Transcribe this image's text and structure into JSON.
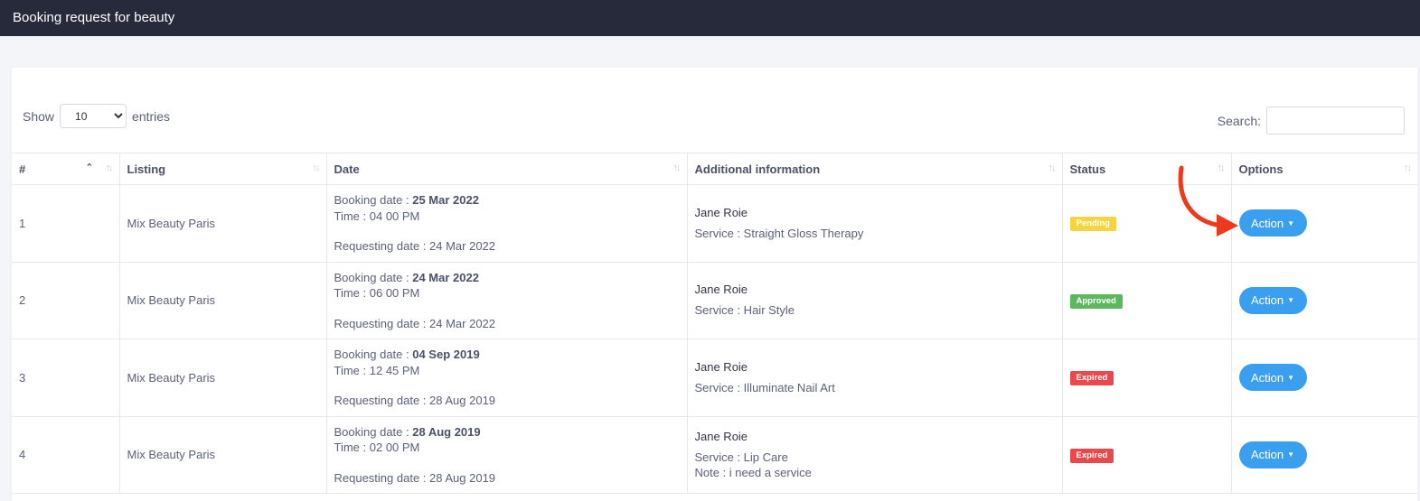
{
  "header": {
    "title": "Booking request for beauty"
  },
  "controls": {
    "show_label": "Show",
    "entries_value": "10",
    "entries_label": "entries",
    "search_label": "Search:"
  },
  "table": {
    "columns": [
      "#",
      "Listing",
      "Date",
      "Additional information",
      "Status",
      "Options"
    ],
    "rows": [
      {
        "num": "1",
        "listing": "Mix Beauty Paris",
        "booking_label": "Booking date : ",
        "booking_date": "25 Mar 2022",
        "time": "Time : 04 00 PM",
        "requesting": "Requesting date : 24 Mar 2022",
        "name": "Jane Roie",
        "service": "Service : Straight Gloss Therapy",
        "note": "",
        "status": "Pending",
        "action": "Action"
      },
      {
        "num": "2",
        "listing": "Mix Beauty Paris",
        "booking_label": "Booking date : ",
        "booking_date": "24 Mar 2022",
        "time": "Time : 06 00 PM",
        "requesting": "Requesting date : 24 Mar 2022",
        "name": "Jane Roie",
        "service": "Service : Hair Style",
        "note": "",
        "status": "Approved",
        "action": "Action"
      },
      {
        "num": "3",
        "listing": "Mix Beauty Paris",
        "booking_label": "Booking date : ",
        "booking_date": "04 Sep 2019",
        "time": "Time : 12 45 PM",
        "requesting": "Requesting date : 28 Aug 2019",
        "name": "Jane Roie",
        "service": "Service : Illuminate Nail Art",
        "note": "",
        "status": "Expired",
        "action": "Action"
      },
      {
        "num": "4",
        "listing": "Mix Beauty Paris",
        "booking_label": "Booking date : ",
        "booking_date": "28 Aug 2019",
        "time": "Time : 02 00 PM",
        "requesting": "Requesting date : 28 Aug 2019",
        "name": "Jane Roie",
        "service": "Service : Lip Care",
        "note": "Note : i need a service",
        "status": "Expired",
        "action": "Action"
      }
    ]
  },
  "colors": {
    "topbar": "#272a3b",
    "pending": "#f5d442",
    "approved": "#5cb85c",
    "expired": "#e9484d",
    "action": "#3b9ff0",
    "arrow": "#ee3a1c"
  },
  "icons": {
    "sort": "sort-icon",
    "sort_asc": "sort-ascending-icon",
    "caret": "caret-down-icon",
    "annotation": "red-curved-arrow-icon"
  }
}
